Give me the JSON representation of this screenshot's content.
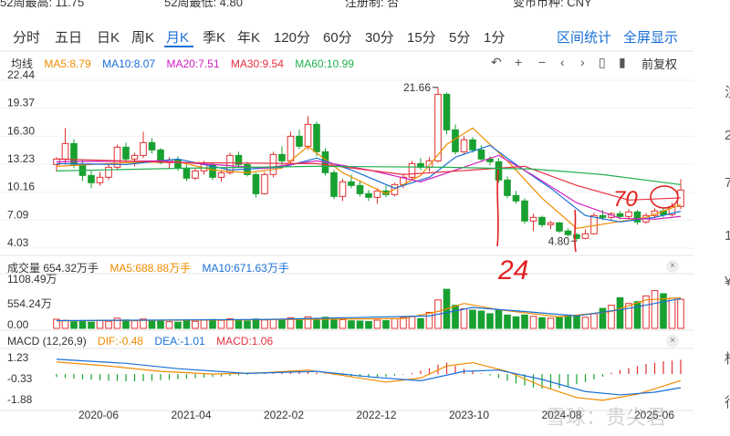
{
  "header_cut": [
    "52周最高: 11.75",
    "52周最低: 4.80",
    "注册制: 否",
    "变市币种: CNY"
  ],
  "tabs": [
    {
      "label": "分时"
    },
    {
      "label": "五日"
    },
    {
      "label": "日K"
    },
    {
      "label": "周K"
    },
    {
      "label": "月K",
      "active": true
    },
    {
      "label": "季K"
    },
    {
      "label": "年K"
    },
    {
      "label": "120分"
    },
    {
      "label": "60分"
    },
    {
      "label": "30分"
    },
    {
      "label": "15分"
    },
    {
      "label": "5分"
    },
    {
      "label": "1分"
    }
  ],
  "links": {
    "interval": "区间统计",
    "fullscreen": "全屏显示"
  },
  "toolbar": {
    "adjust": "前复权",
    "icons": [
      "undo-icon",
      "zoom-in-icon",
      "zoom-out-icon",
      "scroll-left-icon",
      "scroll-right-icon",
      "candle-icon"
    ]
  },
  "colors": {
    "up": "#e03030",
    "down": "#18a030",
    "ma5": "#f08c00",
    "ma10": "#1a6fd6",
    "ma20": "#d020c0",
    "ma30": "#e83040",
    "ma60": "#20b050",
    "accent": "#1a6fd6",
    "annotation": "#e02020"
  },
  "ma_legend": {
    "title": "均线",
    "items": [
      {
        "text": "MA5:8.79",
        "color": "#f08c00"
      },
      {
        "text": "MA10:8.07",
        "color": "#1a6fd6"
      },
      {
        "text": "MA20:7.51",
        "color": "#d020c0"
      },
      {
        "text": "MA30:9.54",
        "color": "#e83040"
      },
      {
        "text": "MA60:10.99",
        "color": "#20b050"
      }
    ]
  },
  "vol_legend": {
    "title": "成交量 654.32万手",
    "items": [
      {
        "text": "MA5:688.88万手",
        "color": "#f08c00"
      },
      {
        "text": "MA10:671.63万手",
        "color": "#1a6fd6"
      }
    ]
  },
  "macd_legend": {
    "title": "MACD (12,26,9)",
    "items": [
      {
        "text": "DIF:-0.48",
        "color": "#f08c00"
      },
      {
        "text": "DEA:-1.01",
        "color": "#1a6fd6"
      },
      {
        "text": "MACD:1.06",
        "color": "#e83040"
      }
    ]
  },
  "right_strip": [
    "注",
    "2",
    "7",
    "1",
    "¥",
    "标",
    "行"
  ],
  "watermark": "雪球：贵尖君",
  "annotations": {
    "left_number": "24",
    "top_number": "70"
  },
  "chart_data": {
    "type": "candlestick",
    "price_ticks": [
      "22.44",
      "19.37",
      "16.30",
      "13.23",
      "10.16",
      "7.09",
      "4.03"
    ],
    "price_range": [
      4.03,
      22.44
    ],
    "x_labels": [
      "2020-06",
      "2021-04",
      "2022-02",
      "2022-12",
      "2023-10",
      "2024-08",
      "2025-06"
    ],
    "high_label": "21.66",
    "low_label": "4.80",
    "candles": [
      [
        13.2,
        14.0,
        12.4,
        13.8
      ],
      [
        13.8,
        17.2,
        13.2,
        15.5
      ],
      [
        15.5,
        16.0,
        12.8,
        13.2
      ],
      [
        13.2,
        13.8,
        11.4,
        12.0
      ],
      [
        12.0,
        12.6,
        10.6,
        11.2
      ],
      [
        11.2,
        12.4,
        10.9,
        11.8
      ],
      [
        11.8,
        13.2,
        11.5,
        12.9
      ],
      [
        12.9,
        15.4,
        12.6,
        15.1
      ],
      [
        15.1,
        15.6,
        13.4,
        13.8
      ],
      [
        13.8,
        14.5,
        13.0,
        14.2
      ],
      [
        14.2,
        16.8,
        13.9,
        15.6
      ],
      [
        15.6,
        16.1,
        14.4,
        14.8
      ],
      [
        14.8,
        15.0,
        13.2,
        13.4
      ],
      [
        13.4,
        14.0,
        12.7,
        13.7
      ],
      [
        13.7,
        14.1,
        12.5,
        12.8
      ],
      [
        12.8,
        13.2,
        11.4,
        11.7
      ],
      [
        11.7,
        12.8,
        11.5,
        12.5
      ],
      [
        12.5,
        13.6,
        12.1,
        13.2
      ],
      [
        13.2,
        13.4,
        11.5,
        11.8
      ],
      [
        11.8,
        12.6,
        11.3,
        12.3
      ],
      [
        12.3,
        14.5,
        12.1,
        14.2
      ],
      [
        14.2,
        14.6,
        12.9,
        13.2
      ],
      [
        13.2,
        13.5,
        11.9,
        12.1
      ],
      [
        12.1,
        12.3,
        9.6,
        10.0
      ],
      [
        10.0,
        12.4,
        9.9,
        12.1
      ],
      [
        12.1,
        14.6,
        11.8,
        14.3
      ],
      [
        14.3,
        15.2,
        13.1,
        13.6
      ],
      [
        13.6,
        16.8,
        13.3,
        16.3
      ],
      [
        16.3,
        17.0,
        14.9,
        15.2
      ],
      [
        15.2,
        18.5,
        14.8,
        17.6
      ],
      [
        17.6,
        17.9,
        14.1,
        14.6
      ],
      [
        14.6,
        15.0,
        12.0,
        12.3
      ],
      [
        12.3,
        12.6,
        9.4,
        9.7
      ],
      [
        9.7,
        11.6,
        9.2,
        11.3
      ],
      [
        11.3,
        12.1,
        10.6,
        10.9
      ],
      [
        10.9,
        11.4,
        9.7,
        10.0
      ],
      [
        10.0,
        10.4,
        9.2,
        9.6
      ],
      [
        9.6,
        10.6,
        8.9,
        10.3
      ],
      [
        10.3,
        10.9,
        9.6,
        9.9
      ],
      [
        9.9,
        11.2,
        9.7,
        11.0
      ],
      [
        11.0,
        12.2,
        10.6,
        11.8
      ],
      [
        11.8,
        13.6,
        11.5,
        13.3
      ],
      [
        13.3,
        13.9,
        12.6,
        12.9
      ],
      [
        12.9,
        14.0,
        12.4,
        13.6
      ],
      [
        13.6,
        21.66,
        13.4,
        20.9
      ],
      [
        20.9,
        21.1,
        16.5,
        17.0
      ],
      [
        17.0,
        17.6,
        14.3,
        14.6
      ],
      [
        14.6,
        16.3,
        14.3,
        15.9
      ],
      [
        15.9,
        16.2,
        14.5,
        14.8
      ],
      [
        14.8,
        15.3,
        13.5,
        13.8
      ],
      [
        13.8,
        14.1,
        13.1,
        13.5
      ],
      [
        13.5,
        13.9,
        11.2,
        11.5
      ],
      [
        11.5,
        11.9,
        9.5,
        9.8
      ],
      [
        9.8,
        10.3,
        8.9,
        9.2
      ],
      [
        9.2,
        9.5,
        6.7,
        7.0
      ],
      [
        7.0,
        7.8,
        5.9,
        7.4
      ],
      [
        7.4,
        7.6,
        6.3,
        6.6
      ],
      [
        6.6,
        7.0,
        6.1,
        6.8
      ],
      [
        6.8,
        6.9,
        5.7,
        5.9
      ],
      [
        5.9,
        6.2,
        5.3,
        5.5
      ],
      [
        5.5,
        5.7,
        4.8,
        5.1
      ],
      [
        5.1,
        6.1,
        5.0,
        5.6
      ],
      [
        5.6,
        7.9,
        5.5,
        7.6
      ],
      [
        7.6,
        8.2,
        7.1,
        7.4
      ],
      [
        7.4,
        8.0,
        7.0,
        7.8
      ],
      [
        7.8,
        8.1,
        7.2,
        7.5
      ],
      [
        7.5,
        8.3,
        7.3,
        8.0
      ],
      [
        8.0,
        8.2,
        6.6,
        6.9
      ],
      [
        6.9,
        7.9,
        6.7,
        7.6
      ],
      [
        7.6,
        8.4,
        7.3,
        8.1
      ],
      [
        8.1,
        8.5,
        7.4,
        7.7
      ],
      [
        7.7,
        9.0,
        7.5,
        8.6
      ],
      [
        8.6,
        11.6,
        8.3,
        10.4
      ]
    ],
    "ma": {
      "ma5": [
        [
          0,
          13.0
        ],
        [
          8,
          13.4
        ],
        [
          14,
          13.5
        ],
        [
          18,
          12.6
        ],
        [
          22,
          12.3
        ],
        [
          26,
          12.8
        ],
        [
          29,
          15.2
        ],
        [
          33,
          12.3
        ],
        [
          38,
          10.0
        ],
        [
          42,
          12.0
        ],
        [
          45,
          15.4
        ],
        [
          48,
          17.2
        ],
        [
          52,
          13.6
        ],
        [
          56,
          9.5
        ],
        [
          60,
          6.2
        ],
        [
          64,
          6.8
        ],
        [
          68,
          7.4
        ],
        [
          72,
          8.79
        ]
      ],
      "ma10": [
        [
          0,
          13.3
        ],
        [
          8,
          13.2
        ],
        [
          14,
          13.8
        ],
        [
          20,
          12.6
        ],
        [
          26,
          12.9
        ],
        [
          30,
          13.9
        ],
        [
          34,
          12.6
        ],
        [
          39,
          10.6
        ],
        [
          43,
          11.8
        ],
        [
          46,
          14.0
        ],
        [
          50,
          15.3
        ],
        [
          53,
          13.2
        ],
        [
          57,
          10.6
        ],
        [
          61,
          7.6
        ],
        [
          65,
          6.9
        ],
        [
          69,
          7.4
        ],
        [
          72,
          8.07
        ]
      ],
      "ma20": [
        [
          0,
          13.5
        ],
        [
          12,
          13.6
        ],
        [
          24,
          12.8
        ],
        [
          30,
          13.6
        ],
        [
          36,
          12.6
        ],
        [
          42,
          11.3
        ],
        [
          47,
          12.9
        ],
        [
          51,
          14.2
        ],
        [
          55,
          12.0
        ],
        [
          60,
          9.0
        ],
        [
          65,
          7.3
        ],
        [
          69,
          7.2
        ],
        [
          72,
          7.51
        ]
      ],
      "ma30": [
        [
          0,
          13.8
        ],
        [
          15,
          13.4
        ],
        [
          30,
          13.3
        ],
        [
          40,
          12.1
        ],
        [
          48,
          12.6
        ],
        [
          54,
          13.0
        ],
        [
          60,
          10.9
        ],
        [
          66,
          9.3
        ],
        [
          72,
          9.54
        ]
      ],
      "ma60": [
        [
          0,
          12.5
        ],
        [
          15,
          12.8
        ],
        [
          30,
          13.0
        ],
        [
          45,
          12.9
        ],
        [
          55,
          12.7
        ],
        [
          63,
          12.1
        ],
        [
          72,
          10.99
        ]
      ]
    },
    "volume": {
      "ticks": [
        "1108.49万",
        "554.24万",
        "0.00"
      ],
      "max": 1108.49,
      "values": [
        205,
        180,
        150,
        165,
        140,
        175,
        160,
        230,
        190,
        170,
        210,
        185,
        165,
        150,
        140,
        175,
        160,
        190,
        200,
        180,
        215,
        175,
        165,
        210,
        190,
        205,
        180,
        240,
        200,
        260,
        220,
        250,
        200,
        195,
        170,
        165,
        155,
        185,
        175,
        215,
        250,
        270,
        220,
        360,
        640,
        880,
        520,
        440,
        410,
        390,
        330,
        420,
        300,
        260,
        300,
        270,
        240,
        230,
        260,
        300,
        280,
        250,
        330,
        450,
        520,
        690,
        560,
        600,
        730,
        850,
        780,
        680,
        654
      ],
      "ma5": [
        [
          0,
          170
        ],
        [
          20,
          190
        ],
        [
          40,
          220
        ],
        [
          44,
          380
        ],
        [
          47,
          560
        ],
        [
          51,
          420
        ],
        [
          58,
          260
        ],
        [
          64,
          380
        ],
        [
          68,
          640
        ],
        [
          72,
          688.88
        ]
      ],
      "ma10": [
        [
          0,
          175
        ],
        [
          24,
          200
        ],
        [
          43,
          280
        ],
        [
          48,
          470
        ],
        [
          54,
          380
        ],
        [
          60,
          280
        ],
        [
          66,
          450
        ],
        [
          72,
          671.63
        ]
      ]
    },
    "macd": {
      "ticks": [
        "1.23",
        "-0.33",
        "-1.88"
      ],
      "range": [
        -2.3,
        1.5
      ],
      "hist": [
        -0.22,
        -0.28,
        -0.34,
        -0.38,
        -0.42,
        -0.46,
        -0.5,
        -0.52,
        -0.55,
        -0.55,
        -0.52,
        -0.5,
        -0.46,
        -0.42,
        -0.38,
        -0.34,
        -0.3,
        -0.26,
        -0.22,
        -0.18,
        -0.14,
        -0.1,
        -0.06,
        -0.03,
        0.04,
        0.1,
        0.16,
        0.22,
        0.26,
        0.2,
        0.12,
        0.05,
        -0.05,
        -0.12,
        -0.18,
        -0.22,
        -0.25,
        -0.26,
        -0.2,
        -0.12,
        -0.05,
        0.08,
        0.25,
        0.45,
        0.7,
        0.85,
        0.6,
        0.4,
        0.2,
        0.05,
        -0.1,
        -0.3,
        -0.5,
        -0.7,
        -0.85,
        -1.0,
        -1.08,
        -1.1,
        -1.05,
        -0.9,
        -0.75,
        -0.6,
        -0.4,
        -0.2,
        0.1,
        0.3,
        0.45,
        0.6,
        0.75,
        0.85,
        0.95,
        1.0,
        1.06
      ],
      "dif": [
        [
          0,
          0.9
        ],
        [
          6,
          0.6
        ],
        [
          12,
          0.2
        ],
        [
          18,
          0.0
        ],
        [
          24,
          0.1
        ],
        [
          29,
          0.3
        ],
        [
          33,
          -0.1
        ],
        [
          38,
          -0.6
        ],
        [
          42,
          -0.3
        ],
        [
          45,
          0.6
        ],
        [
          48,
          0.85
        ],
        [
          52,
          0.2
        ],
        [
          56,
          -0.9
        ],
        [
          60,
          -1.75
        ],
        [
          63,
          -1.95
        ],
        [
          67,
          -1.5
        ],
        [
          72,
          -0.48
        ]
      ],
      "dea": [
        [
          0,
          1.1
        ],
        [
          8,
          0.8
        ],
        [
          14,
          0.4
        ],
        [
          22,
          0.05
        ],
        [
          30,
          0.2
        ],
        [
          36,
          -0.2
        ],
        [
          42,
          -0.5
        ],
        [
          47,
          0.2
        ],
        [
          51,
          0.3
        ],
        [
          56,
          -0.4
        ],
        [
          61,
          -1.3
        ],
        [
          65,
          -1.55
        ],
        [
          69,
          -1.35
        ],
        [
          72,
          -1.01
        ]
      ]
    }
  }
}
